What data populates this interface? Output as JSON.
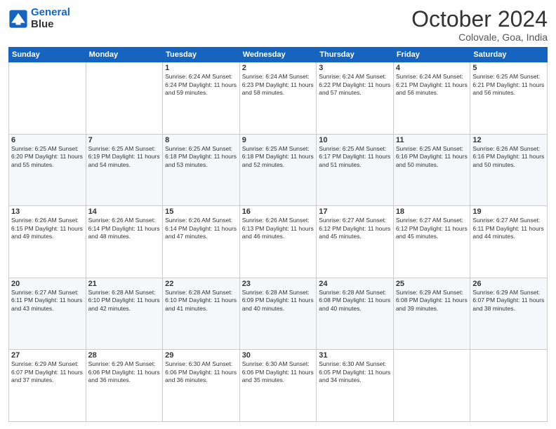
{
  "header": {
    "logo_line1": "General",
    "logo_line2": "Blue",
    "month": "October 2024",
    "location": "Colovale, Goa, India"
  },
  "days_of_week": [
    "Sunday",
    "Monday",
    "Tuesday",
    "Wednesday",
    "Thursday",
    "Friday",
    "Saturday"
  ],
  "weeks": [
    [
      {
        "day": "",
        "info": ""
      },
      {
        "day": "",
        "info": ""
      },
      {
        "day": "1",
        "info": "Sunrise: 6:24 AM\nSunset: 6:24 PM\nDaylight: 11 hours and 59 minutes."
      },
      {
        "day": "2",
        "info": "Sunrise: 6:24 AM\nSunset: 6:23 PM\nDaylight: 11 hours and 58 minutes."
      },
      {
        "day": "3",
        "info": "Sunrise: 6:24 AM\nSunset: 6:22 PM\nDaylight: 11 hours and 57 minutes."
      },
      {
        "day": "4",
        "info": "Sunrise: 6:24 AM\nSunset: 6:21 PM\nDaylight: 11 hours and 56 minutes."
      },
      {
        "day": "5",
        "info": "Sunrise: 6:25 AM\nSunset: 6:21 PM\nDaylight: 11 hours and 56 minutes."
      }
    ],
    [
      {
        "day": "6",
        "info": "Sunrise: 6:25 AM\nSunset: 6:20 PM\nDaylight: 11 hours and 55 minutes."
      },
      {
        "day": "7",
        "info": "Sunrise: 6:25 AM\nSunset: 6:19 PM\nDaylight: 11 hours and 54 minutes."
      },
      {
        "day": "8",
        "info": "Sunrise: 6:25 AM\nSunset: 6:18 PM\nDaylight: 11 hours and 53 minutes."
      },
      {
        "day": "9",
        "info": "Sunrise: 6:25 AM\nSunset: 6:18 PM\nDaylight: 11 hours and 52 minutes."
      },
      {
        "day": "10",
        "info": "Sunrise: 6:25 AM\nSunset: 6:17 PM\nDaylight: 11 hours and 51 minutes."
      },
      {
        "day": "11",
        "info": "Sunrise: 6:25 AM\nSunset: 6:16 PM\nDaylight: 11 hours and 50 minutes."
      },
      {
        "day": "12",
        "info": "Sunrise: 6:26 AM\nSunset: 6:16 PM\nDaylight: 11 hours and 50 minutes."
      }
    ],
    [
      {
        "day": "13",
        "info": "Sunrise: 6:26 AM\nSunset: 6:15 PM\nDaylight: 11 hours and 49 minutes."
      },
      {
        "day": "14",
        "info": "Sunrise: 6:26 AM\nSunset: 6:14 PM\nDaylight: 11 hours and 48 minutes."
      },
      {
        "day": "15",
        "info": "Sunrise: 6:26 AM\nSunset: 6:14 PM\nDaylight: 11 hours and 47 minutes."
      },
      {
        "day": "16",
        "info": "Sunrise: 6:26 AM\nSunset: 6:13 PM\nDaylight: 11 hours and 46 minutes."
      },
      {
        "day": "17",
        "info": "Sunrise: 6:27 AM\nSunset: 6:12 PM\nDaylight: 11 hours and 45 minutes."
      },
      {
        "day": "18",
        "info": "Sunrise: 6:27 AM\nSunset: 6:12 PM\nDaylight: 11 hours and 45 minutes."
      },
      {
        "day": "19",
        "info": "Sunrise: 6:27 AM\nSunset: 6:11 PM\nDaylight: 11 hours and 44 minutes."
      }
    ],
    [
      {
        "day": "20",
        "info": "Sunrise: 6:27 AM\nSunset: 6:11 PM\nDaylight: 11 hours and 43 minutes."
      },
      {
        "day": "21",
        "info": "Sunrise: 6:28 AM\nSunset: 6:10 PM\nDaylight: 11 hours and 42 minutes."
      },
      {
        "day": "22",
        "info": "Sunrise: 6:28 AM\nSunset: 6:10 PM\nDaylight: 11 hours and 41 minutes."
      },
      {
        "day": "23",
        "info": "Sunrise: 6:28 AM\nSunset: 6:09 PM\nDaylight: 11 hours and 40 minutes."
      },
      {
        "day": "24",
        "info": "Sunrise: 6:28 AM\nSunset: 6:08 PM\nDaylight: 11 hours and 40 minutes."
      },
      {
        "day": "25",
        "info": "Sunrise: 6:29 AM\nSunset: 6:08 PM\nDaylight: 11 hours and 39 minutes."
      },
      {
        "day": "26",
        "info": "Sunrise: 6:29 AM\nSunset: 6:07 PM\nDaylight: 11 hours and 38 minutes."
      }
    ],
    [
      {
        "day": "27",
        "info": "Sunrise: 6:29 AM\nSunset: 6:07 PM\nDaylight: 11 hours and 37 minutes."
      },
      {
        "day": "28",
        "info": "Sunrise: 6:29 AM\nSunset: 6:06 PM\nDaylight: 11 hours and 36 minutes."
      },
      {
        "day": "29",
        "info": "Sunrise: 6:30 AM\nSunset: 6:06 PM\nDaylight: 11 hours and 36 minutes."
      },
      {
        "day": "30",
        "info": "Sunrise: 6:30 AM\nSunset: 6:06 PM\nDaylight: 11 hours and 35 minutes."
      },
      {
        "day": "31",
        "info": "Sunrise: 6:30 AM\nSunset: 6:05 PM\nDaylight: 11 hours and 34 minutes."
      },
      {
        "day": "",
        "info": ""
      },
      {
        "day": "",
        "info": ""
      }
    ]
  ]
}
